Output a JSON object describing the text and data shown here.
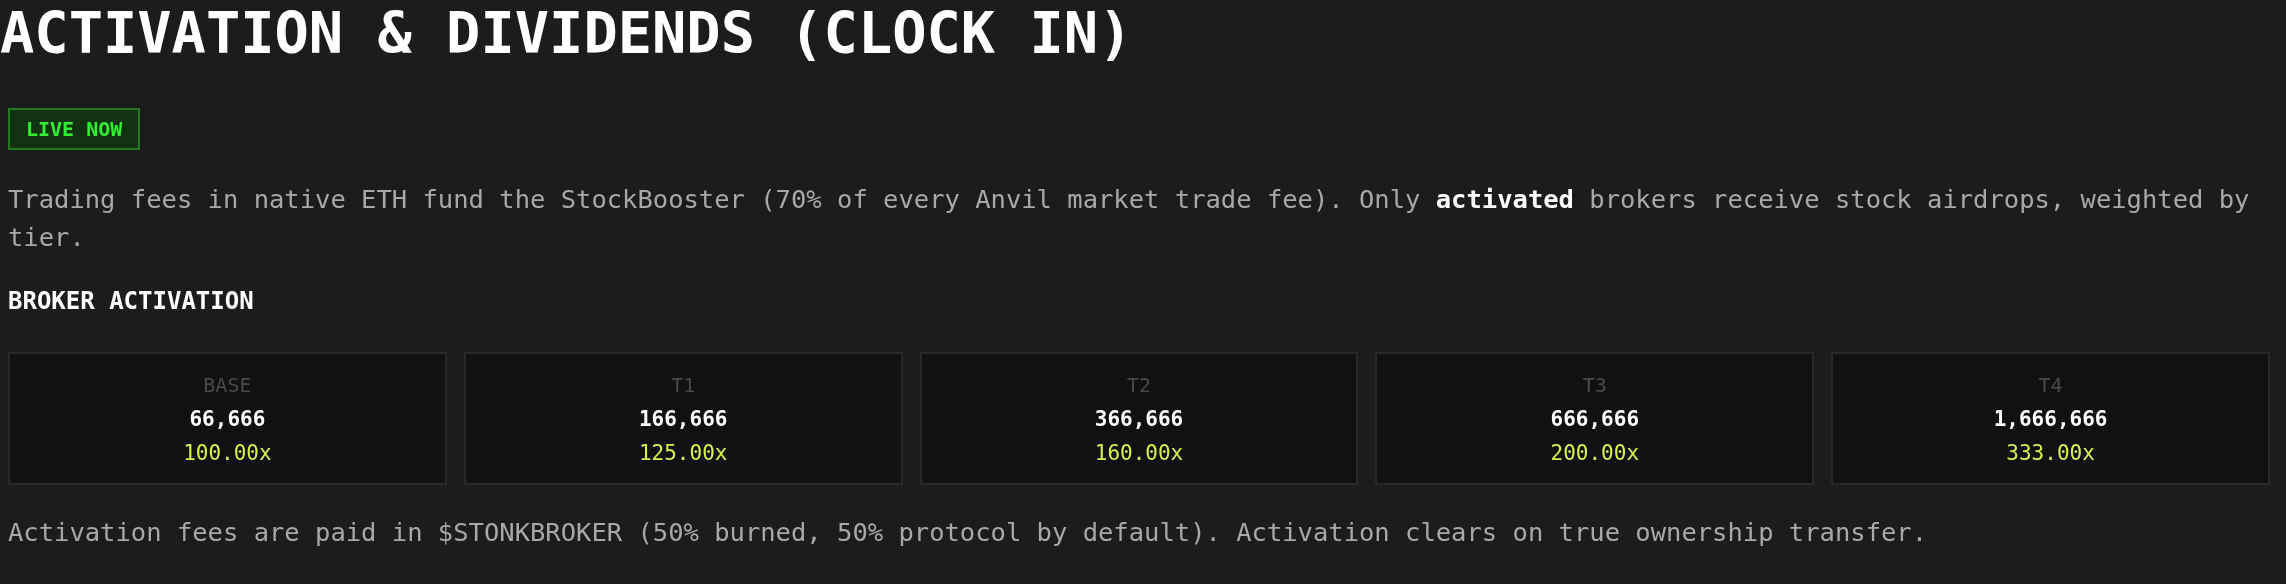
{
  "title": "ACTIVATION & DIVIDENDS (CLOCK IN)",
  "status_badge": "LIVE NOW",
  "intro": "Trading fees in native ETH fund the StockBooster (70% of every Anvil market trade fee). Only **activated** brokers receive stock airdrops, weighted by tier.",
  "section_heading": "BROKER ACTIVATION",
  "tiers": [
    {
      "label": "BASE",
      "amount": "66,666",
      "multiplier": "100.00x"
    },
    {
      "label": "T1",
      "amount": "166,666",
      "multiplier": "125.00x"
    },
    {
      "label": "T2",
      "amount": "366,666",
      "multiplier": "160.00x"
    },
    {
      "label": "T3",
      "amount": "666,666",
      "multiplier": "200.00x"
    },
    {
      "label": "T4",
      "amount": "1,666,666",
      "multiplier": "333.00x"
    }
  ],
  "footnote": "Activation fees are paid in $STONKBROKER (50% burned, 50% protocol by default). Activation clears on true ownership transfer."
}
